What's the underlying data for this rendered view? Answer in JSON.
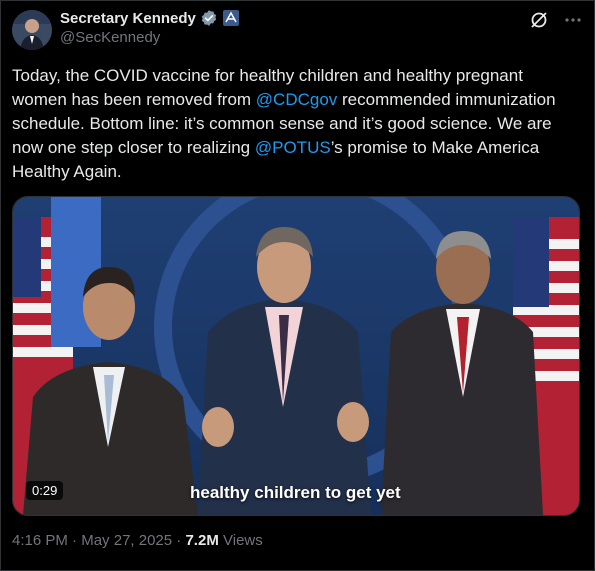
{
  "author": {
    "display_name": "Secretary Kennedy",
    "handle": "@SecKennedy"
  },
  "icons": {
    "verified": "verified-badge-icon",
    "affiliate": "government-affiliate-icon",
    "grok": "grok-icon",
    "more": "more-options-icon"
  },
  "tweet": {
    "text_before_1": "Today, the COVID vaccine for healthy children and healthy pregnant women has been removed from ",
    "mention_1": "@CDCgov",
    "text_between": " recommended immunization schedule. Bottom line: it’s common sense and it’s good science. We are now one step closer to realizing ",
    "mention_2": "@POTUS",
    "text_after": "’s promise to Make America Healthy Again."
  },
  "video": {
    "duration": "0:29",
    "caption": "healthy children to get yet"
  },
  "meta": {
    "time": "4:16 PM",
    "date": "May 27, 2025",
    "separator": " · ",
    "views_count": "7.2M",
    "views_label": "Views"
  },
  "colors": {
    "background": "#000000",
    "text": "#e7e9ea",
    "secondary": "#71767b",
    "link": "#1d9bf0",
    "border": "#2f3336"
  }
}
